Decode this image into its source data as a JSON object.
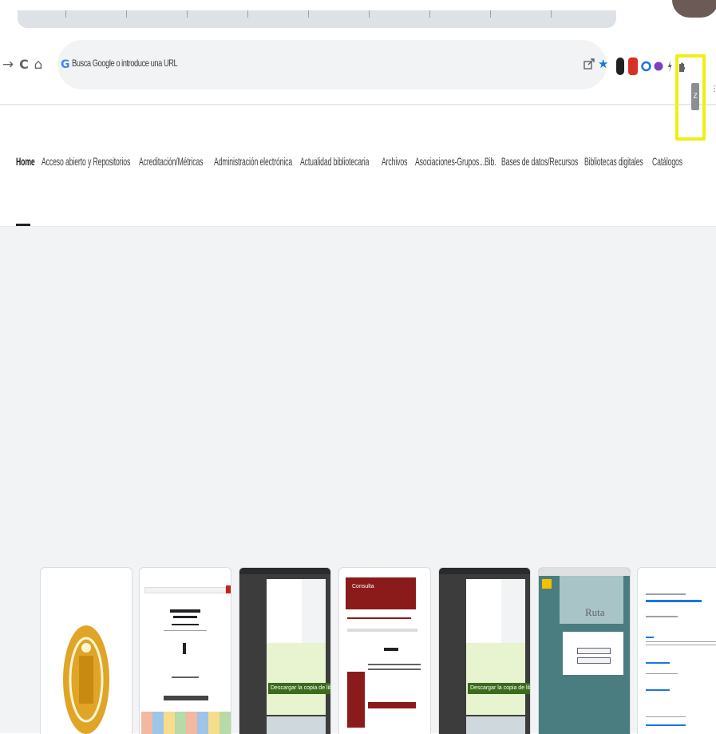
{
  "toolbar": {
    "back_icon": "→",
    "reload_icon": "C",
    "home_icon": "⌂",
    "omnibox_placeholder": "Busca Google o introduce una URL",
    "google_icon": "G",
    "star_icon": "★",
    "extension_z_label": "Z"
  },
  "bookmarks": [
    "Home",
    "Acceso abierto y Repositorios",
    "Acreditación/Métricas",
    "Administración electrónica",
    "Actualidad bibliotecaria",
    "Archivos",
    "Asociaciones-Grupos...Bib.",
    "Bases de datos/Recursos",
    "Bibliotecas digitales",
    "Catálogos"
  ],
  "thumbs": {
    "t3_button": "Descargar la copia de libro",
    "t5_button": "Descargar la copia de libro",
    "t4_title": "Consulta",
    "t6_title": "Ruta"
  },
  "colors": {
    "highlight": "#f2ee12",
    "omnibox_bg": "#f1f3f4",
    "accent": "#1a73e8"
  }
}
